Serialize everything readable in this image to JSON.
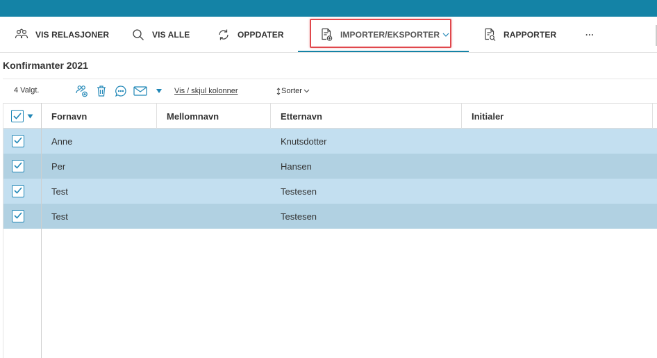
{
  "toolbar": {
    "items": [
      {
        "label": "VIS RELASJONER",
        "icon": "relations-icon"
      },
      {
        "label": "VIS ALLE",
        "icon": "search-icon"
      },
      {
        "label": "OPPDATER",
        "icon": "refresh-icon"
      },
      {
        "label": "IMPORTER/EKSPORTER",
        "icon": "import-export-icon"
      },
      {
        "label": "RAPPORTER",
        "icon": "report-icon"
      },
      {
        "label": "···",
        "icon": "more-icon"
      }
    ],
    "active_index": 3
  },
  "section": {
    "title": "Konfirmanter 2021"
  },
  "actions": {
    "selected_count": "4 Valgt.",
    "icons": [
      "add-person-icon",
      "trash-icon",
      "chat-icon",
      "mail-icon",
      "dropdown-arrow-icon"
    ],
    "columns_link": "Vis / skjul kolonner",
    "sort_label": "Sorter"
  },
  "table": {
    "columns": [
      "Fornavn",
      "Mellomnavn",
      "Etternavn",
      "Initialer"
    ],
    "rows": [
      {
        "checked": true,
        "fornavn": "Anne",
        "mellomnavn": "",
        "etternavn": "Knutsdotter",
        "initialer": ""
      },
      {
        "checked": true,
        "fornavn": "Per",
        "mellomnavn": "",
        "etternavn": "Hansen",
        "initialer": ""
      },
      {
        "checked": true,
        "fornavn": "Test",
        "mellomnavn": "",
        "etternavn": "Testesen",
        "initialer": ""
      },
      {
        "checked": true,
        "fornavn": "Test",
        "mellomnavn": "",
        "etternavn": "Testesen",
        "initialer": ""
      }
    ]
  },
  "colors": {
    "topbar": "#1483a6",
    "row_odd": "#c3dff0",
    "row_even": "#b1d1e2",
    "accent": "#1f86b6",
    "highlight": "#e0474c"
  }
}
